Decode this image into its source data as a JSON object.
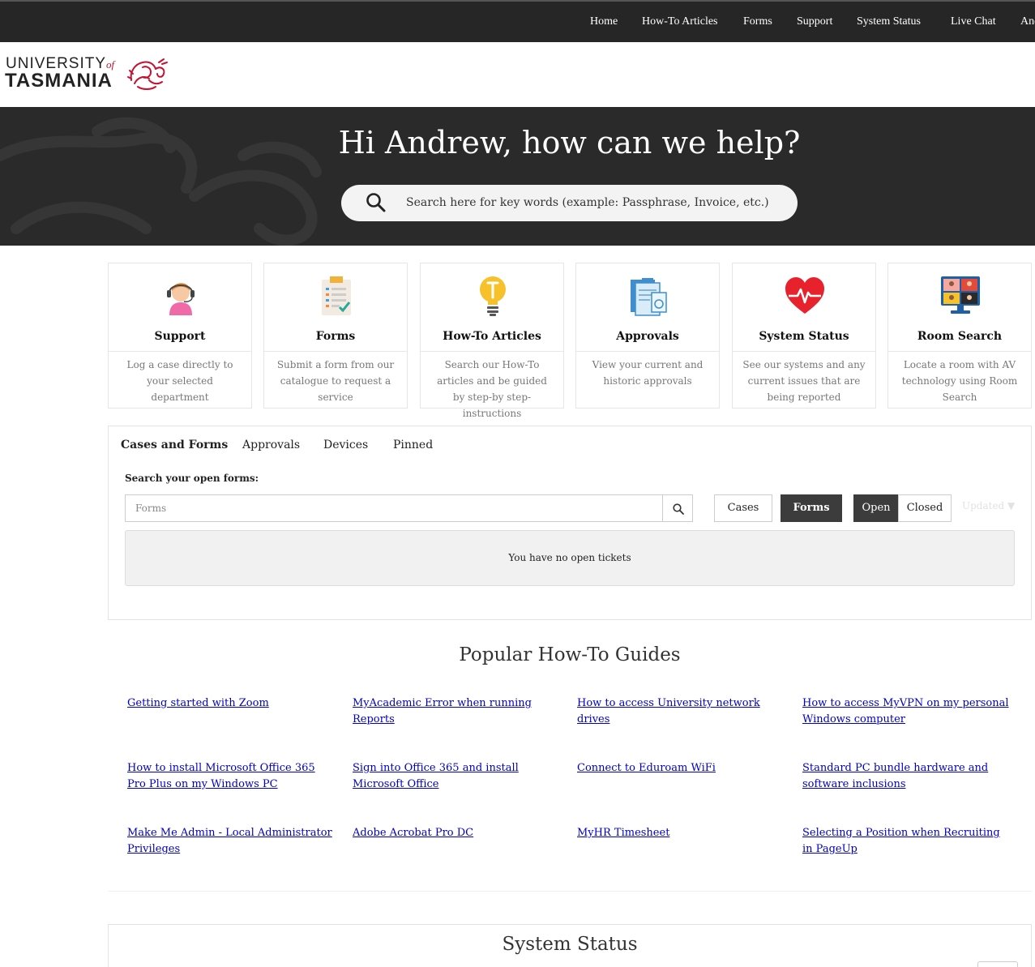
{
  "nav": {
    "items": [
      "Home",
      "How-To Articles",
      "Forms",
      "Support",
      "System Status",
      "Live Chat",
      "Andrew"
    ]
  },
  "logo": {
    "line1": "UNIVERSITY",
    "of": "of",
    "line2": "TASMANIA"
  },
  "hero": {
    "greeting": "Hi Andrew, how can we help?",
    "search_placeholder": "Search here for key words (example: Passphrase, Invoice, etc.)"
  },
  "tiles": [
    {
      "title": "Support",
      "desc": "Log a case directly to your selected department",
      "icon": "headset-agent-icon"
    },
    {
      "title": "Forms",
      "desc": "Submit a form from our catalogue to request a service",
      "icon": "clipboard-checklist-icon"
    },
    {
      "title": "How-To Articles",
      "desc": "Search our How-To articles and be guided by step-by step-instructions",
      "icon": "lightbulb-icon"
    },
    {
      "title": "Approvals",
      "desc": "View your current and historic approvals",
      "icon": "approval-documents-icon"
    },
    {
      "title": "System Status",
      "desc": "See our systems and any current issues that are being reported",
      "icon": "heartbeat-icon"
    },
    {
      "title": "Room Search",
      "desc": "Locate a room with AV technology using Room Search",
      "icon": "video-conference-monitor-icon"
    }
  ],
  "cases": {
    "tabs": [
      "Cases and Forms",
      "Approvals",
      "Devices",
      "Pinned"
    ],
    "search_label": "Search your open forms:",
    "search_placeholder": "Forms",
    "type_buttons": [
      "Cases",
      "Forms"
    ],
    "state_buttons": [
      "Open",
      "Closed"
    ],
    "sort_label": "Updated ▼",
    "empty_message": "You have no open tickets"
  },
  "guides": {
    "title": "Popular How-To Guides",
    "links": [
      "Getting started with Zoom",
      "MyAcademic Error when running Reports",
      "How to access University network drives",
      "How to access MyVPN on my personal Windows computer",
      "How to install Microsoft Office 365 Pro Plus on my Windows PC",
      "Sign into Office 365 and install Microsoft Office",
      "Connect to Eduroam WiFi",
      "Standard PC bundle hardware and software inclusions",
      "Make Me Admin - Local Administrator Privileges",
      "Adobe Acrobat Pro DC",
      "MyHR Timesheet",
      "Selecting a Position when Recruiting in PageUp"
    ]
  },
  "status": {
    "title": "System Status"
  },
  "colors": {
    "nav_bg": "#262626",
    "hero_bg": "#2a2a2a",
    "brand_red": "#c8102e",
    "link": "#0000cc",
    "dark_button": "#3c3c3c"
  }
}
